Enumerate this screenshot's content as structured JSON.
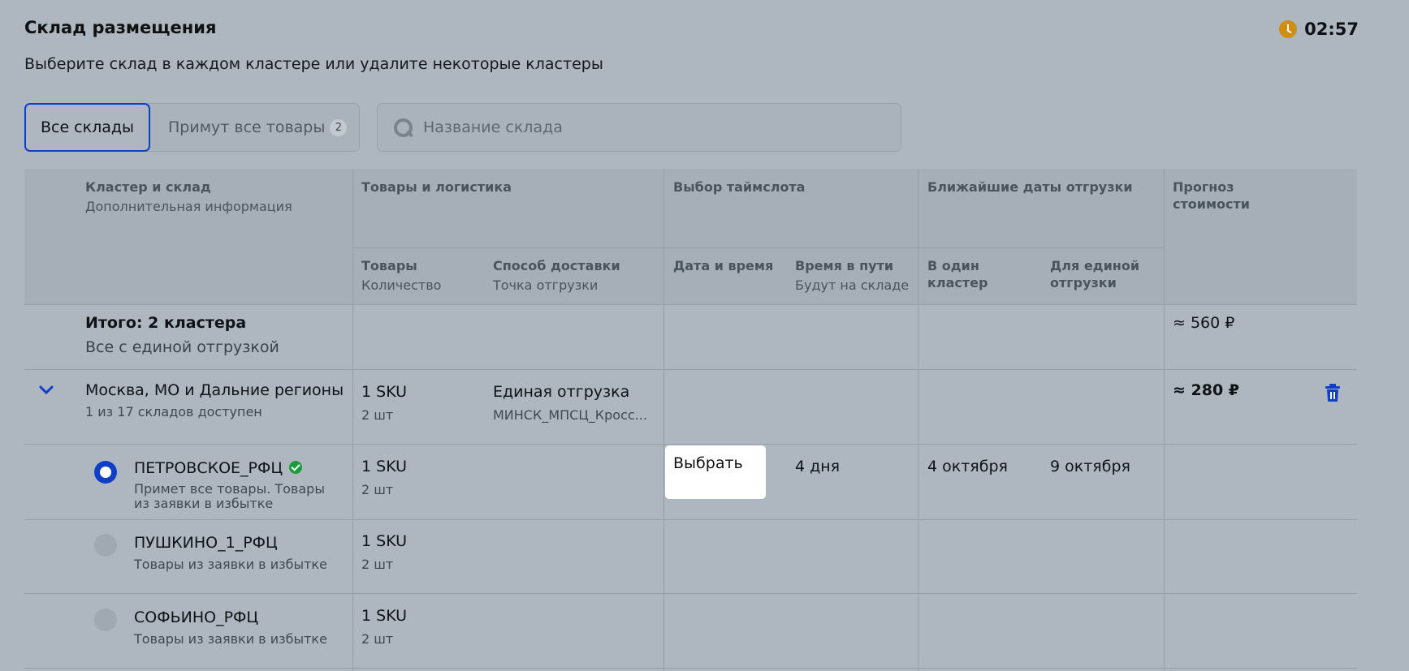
{
  "header": {
    "title": "Склад размещения",
    "subtitle": "Выберите склад в каждом кластере или удалите некоторые кластеры",
    "timer": "02:57"
  },
  "tabs": {
    "all": "Все склады",
    "accept_all": "Примут все товары",
    "accept_all_count": "2"
  },
  "search": {
    "placeholder": "Название склада"
  },
  "columns": {
    "cluster": "Кластер и склад",
    "cluster_sub": "Дополнительная информация",
    "goods_logistics": "Товары и логистика",
    "goods": "Товары",
    "goods_sub": "Количество",
    "delivery": "Способ доставки",
    "delivery_sub": "Точка отгрузки",
    "timeslot": "Выбор таймслота",
    "datetime": "Дата и время",
    "transit": "Время в пути",
    "transit_sub": "Будут на складе",
    "nearest": "Ближайшие даты отгрузки",
    "one_cluster": "В один кластер",
    "single_shipment": "Для единой отгрузки",
    "forecast": "Прогноз стоимости"
  },
  "total": {
    "label": "Итого: 2 кластера",
    "sub": "Все с единой отгрузкой",
    "price": "≈ 560 ₽"
  },
  "cluster": {
    "name": "Москва, МО и Дальние регионы",
    "sub": "1 из 17 складов доступен",
    "sku": "1 SKU",
    "qty": "2 шт",
    "delivery": "Единая отгрузка",
    "point": "МИНСК_МПСЦ_Кросс...",
    "price": "≈ 280 ₽"
  },
  "warehouses": [
    {
      "name": "ПЕТРОВСКОЕ_РФЦ",
      "note": "Примет все товары. Товары из заявки в избытке",
      "sku": "1 SKU",
      "qty": "2 шт",
      "select_label": "Выбрать",
      "transit": "4 дня",
      "one_cluster_date": "4 октября",
      "single_date": "9 октября",
      "selected": true
    },
    {
      "name": "ПУШКИНО_1_РФЦ",
      "note": "Товары из заявки в избытке",
      "sku": "1 SKU",
      "qty": "2 шт",
      "selected": false
    },
    {
      "name": "СОФЬИНО_РФЦ",
      "note": "Товары из заявки в избытке",
      "sku": "1 SKU",
      "qty": "2 шт",
      "selected": false
    }
  ],
  "colors": {
    "accent": "#0f3fc8",
    "timer": "#d08e10",
    "check": "#1c9c3c"
  }
}
